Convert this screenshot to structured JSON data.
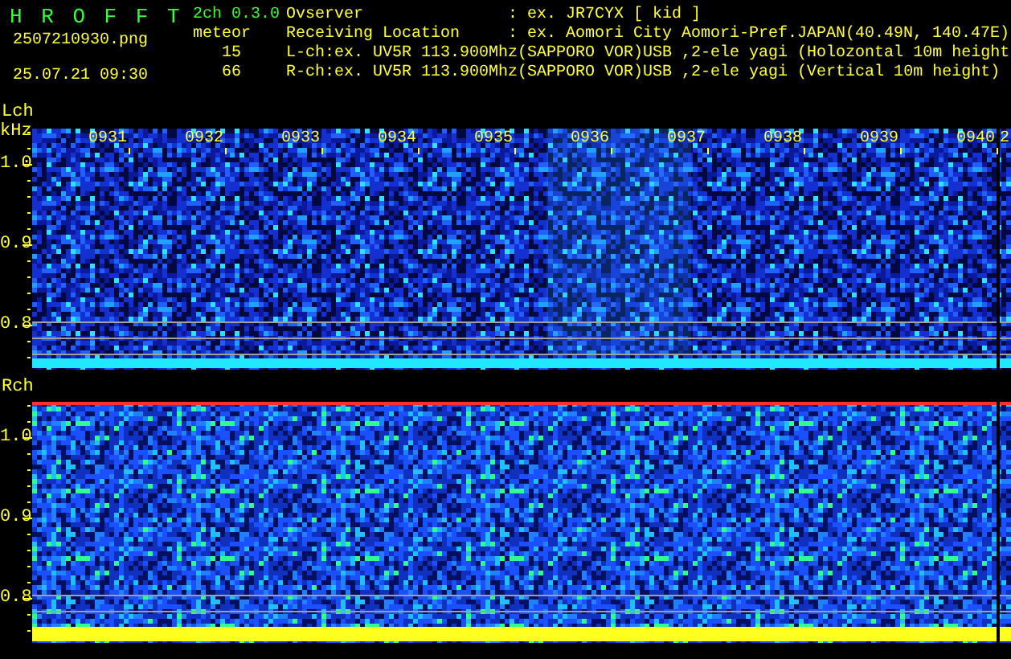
{
  "header": {
    "app_name": "H R O F F T",
    "version": "2ch 0.3.0",
    "filename": "2507210930.png",
    "datetime": "25.07.21 09:30",
    "mode": "meteor",
    "counts": [
      "15",
      "66"
    ],
    "fields": [
      {
        "label": "Ovserver",
        "value": ": ex. JR7CYX [ kid ]"
      },
      {
        "label": "Receiving Location",
        "value": ": ex. Aomori City Aomori-Pref.JAPAN(40.49N, 140.47E)"
      }
    ],
    "channel_lines": [
      "L-ch:ex. UV5R 113.900Mhz(SAPPORO VOR)USB ,2-ele yagi (Holozontal 10m height",
      "R-ch:ex. UV5R 113.900Mhz(SAPPORO VOR)USB ,2-ele yagi (Vertical 10m height)"
    ]
  },
  "panels": [
    {
      "label": "Lch",
      "unit": "kHz",
      "yticks": [
        "1.0",
        "0.9",
        "0.8"
      ],
      "time_labels": [
        "0931",
        "0932",
        "0933",
        "0934",
        "0935",
        "0936",
        "0937",
        "0938",
        "0939",
        "0940"
      ],
      "edge_label": "2"
    },
    {
      "label": "Rch",
      "yticks": [
        "1.0",
        "0.9",
        "0.8"
      ]
    }
  ]
}
